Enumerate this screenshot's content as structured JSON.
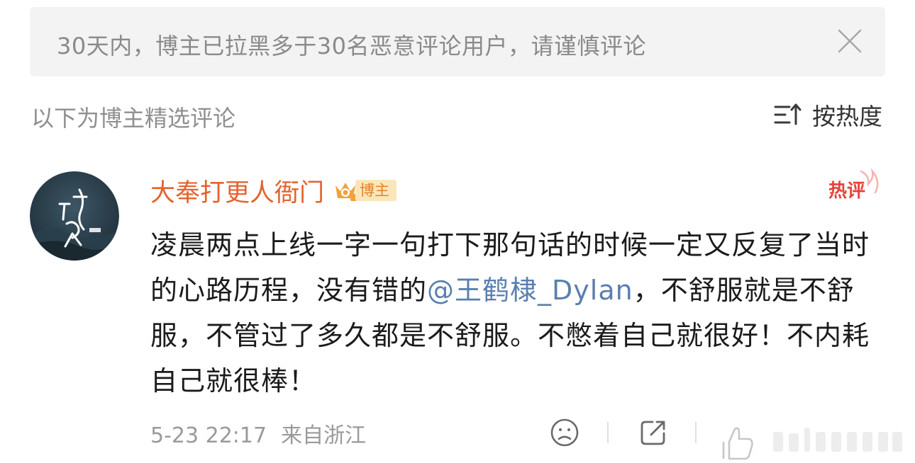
{
  "banner": {
    "text": "30天内，博主已拉黑多于30名恶意评论用户，请谨慎评论"
  },
  "section": {
    "title": "以下为博主精选评论",
    "sort_label": "按热度"
  },
  "comment": {
    "username": "大奉打更人衙门",
    "badge": "博主",
    "hot_tag": "热评",
    "text_before": "凌晨两点上线一字一句打下那句话的时候一定又反复了当时的心路历程，没有错的",
    "mention": "@王鹤棣_Dylan",
    "text_after": "，不舒服就是不舒服，不管过了多久都是不舒服。不憋着自己就很好！不内耗自己就很棒！",
    "time": "5-23 22:17",
    "location": "来自浙江",
    "avatar_text": "大奉打更人"
  },
  "colors": {
    "username": "#e3632e",
    "mention": "#5a7fb0",
    "hot": "#e8423a",
    "badge_bg": "#fbe6bc"
  }
}
